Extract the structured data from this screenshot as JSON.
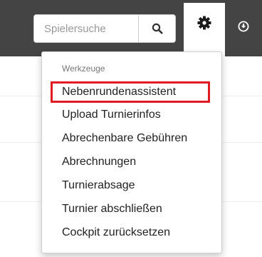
{
  "navbar": {
    "search": {
      "placeholder": "Spielersuche",
      "value": ""
    },
    "search_button_icon": "search-icon",
    "settings_icon": "gear-icon",
    "extra_icon": "download-circle-icon",
    "colors": {
      "bar": "#444444",
      "highlight": "#e01b24"
    }
  },
  "dropdown": {
    "header": "Werkzeuge",
    "items": [
      {
        "label": "Nebenrundenassistent",
        "highlighted": true
      },
      {
        "label": "Upload Turnierinfos"
      },
      {
        "label": "Abrechenbare Gebühren"
      },
      {
        "label": "Abrechnungen"
      },
      {
        "label": "Turnierabsage"
      },
      {
        "label": "Turnier abschließen"
      },
      {
        "label": "Cockpit zurücksetzen"
      }
    ]
  }
}
